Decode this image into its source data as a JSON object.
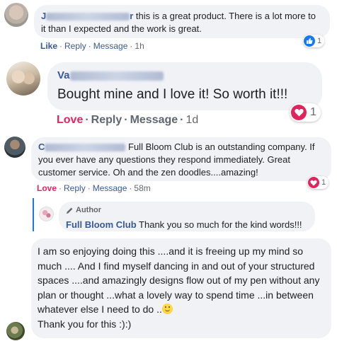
{
  "comments": [
    {
      "author_visible": "J",
      "author_tail": "r",
      "text_first": " this is a great product. There is a lot more to",
      "text_rest": "it than I expected and the work is great.",
      "actions": {
        "like": "Like",
        "reply": "Reply",
        "message": "Message",
        "time": "1h",
        "dot": "·"
      },
      "reaction": {
        "icon": "like-icon",
        "count": "1",
        "color": "#1877f2"
      }
    },
    {
      "author_visible": "Va",
      "text": "Bought mine and I love it! So worth it!!!",
      "actions": {
        "love": "Love",
        "reply": "Reply",
        "message": "Message",
        "time": "1d",
        "dot": "·"
      },
      "reaction": {
        "icon": "heart-icon",
        "count": "1",
        "color": "#e0245e"
      }
    },
    {
      "author_visible": "C",
      "text_first": "Full Bloom Club is an outstanding company. If",
      "text_rest": "you ever have any questions they respond immediately. Great customer service. Oh and the zen doodles....amazing!",
      "actions": {
        "love": "Love",
        "reply": "Reply",
        "message": "Message",
        "time": "58m",
        "dot": "·"
      },
      "reaction": {
        "icon": "heart-icon",
        "count": "1",
        "color": "#e0245e"
      },
      "reply": {
        "badge": "Author",
        "author": "Full Bloom Club",
        "text": "Thank you so much for the kind words!!!"
      }
    },
    {
      "text_main": "I am so enjoying doing this ....and it is freeing up my mind so much .... And I find myself dancing in and out of your structured spaces ....and amazingly designs flow out of my pen without any plan or thought ...what a lovely way to spend time ...in between whatever else I need to do ..",
      "emoji": "😀",
      "text_end": "Thank you for this :):)"
    }
  ],
  "colors": {
    "link": "#385898",
    "love": "#e0245e",
    "like": "#1877f2",
    "bubble": "#f0f2f5"
  }
}
